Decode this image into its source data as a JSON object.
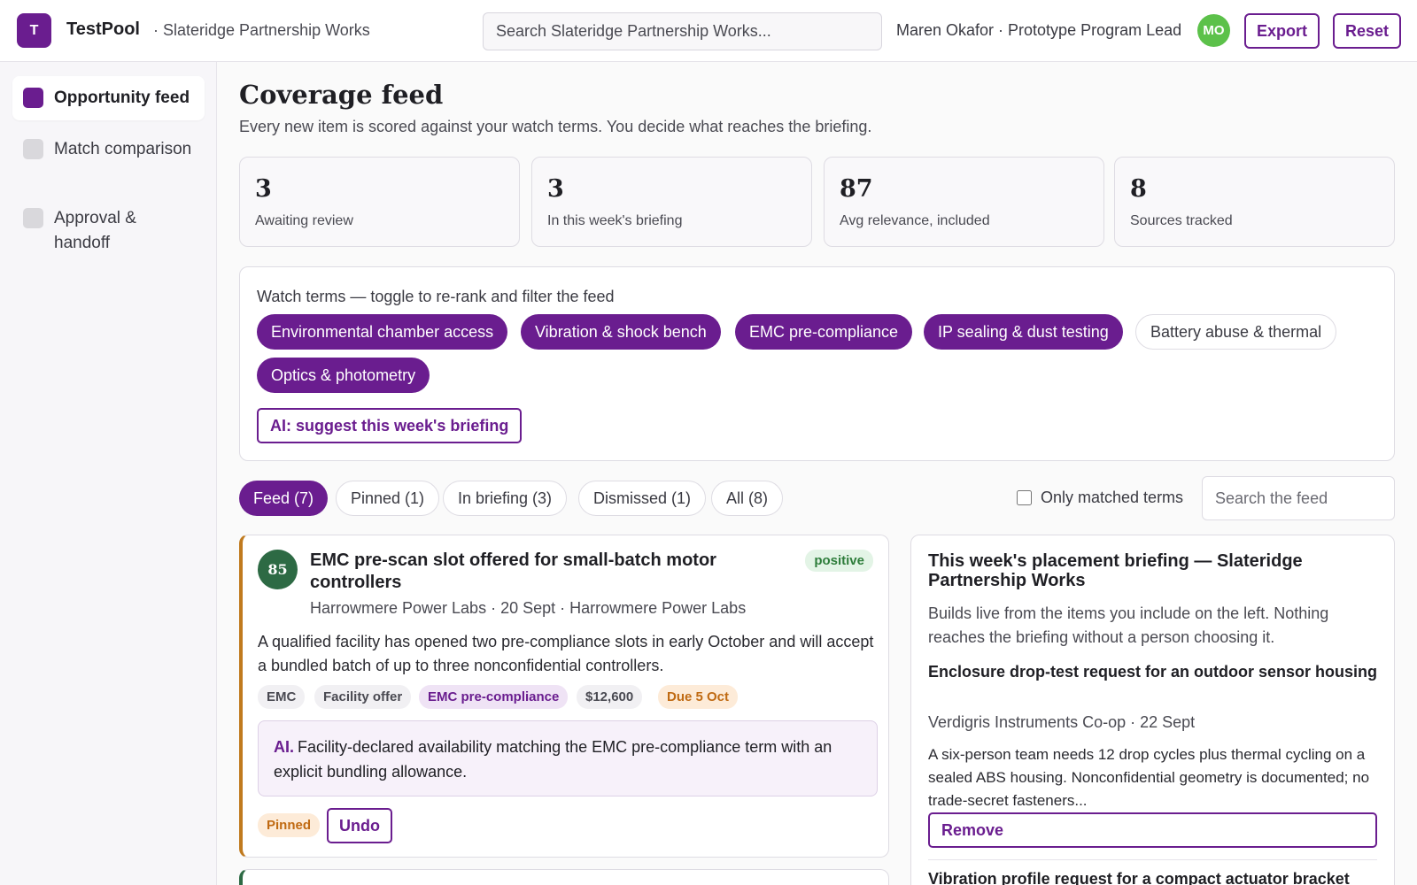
{
  "header": {
    "logo_letter": "T",
    "app_name": "TestPool",
    "org": "· Slateridge Partnership Works",
    "search_placeholder": "Search Slateridge Partnership Works...",
    "user": "Maren Okafor · Prototype Program Lead",
    "avatar_initials": "MO",
    "export_label": "Export",
    "reset_label": "Reset"
  },
  "sidebar": {
    "items": [
      {
        "label": "Opportunity feed",
        "active": true
      },
      {
        "label": "Match comparison",
        "active": false
      },
      {
        "label": "Approval & handoff",
        "active": false
      }
    ]
  },
  "main": {
    "title": "Coverage feed",
    "subtitle": "Every new item is scored against your watch terms. You decide what reaches the briefing."
  },
  "stats": [
    {
      "value": "3",
      "label": "Awaiting review"
    },
    {
      "value": "3",
      "label": "In this week's briefing"
    },
    {
      "value": "87",
      "label": "Avg relevance, included"
    },
    {
      "value": "8",
      "label": "Sources tracked"
    }
  ],
  "watch": {
    "label": "Watch terms — toggle to re-rank and filter the feed",
    "terms": [
      {
        "label": "Environmental chamber access",
        "on": true
      },
      {
        "label": "Vibration & shock bench",
        "on": true
      },
      {
        "label": "EMC pre-compliance",
        "on": true
      },
      {
        "label": "IP sealing & dust testing",
        "on": true
      },
      {
        "label": "Battery abuse & thermal",
        "on": false
      },
      {
        "label": "Optics & photometry",
        "on": true
      }
    ],
    "ai_button": "AI: suggest this week's briefing"
  },
  "tabs": [
    {
      "label": "Feed (7)",
      "active": true
    },
    {
      "label": "Pinned (1)",
      "active": false
    },
    {
      "label": "In briefing (3)",
      "active": false
    },
    {
      "label": "Dismissed (1)",
      "active": false
    },
    {
      "label": "All (8)",
      "active": false
    }
  ],
  "filter": {
    "only_matched_label": "Only matched terms",
    "only_matched_checked": false,
    "search_placeholder": "Search the feed"
  },
  "card": {
    "score": "85",
    "title": "EMC pre-scan slot offered for small-batch motor controllers",
    "sentiment": "positive",
    "meta": "Harrowmere Power Labs · 20 Sept · Harrowmere Power Labs",
    "body": "A qualified facility has opened two pre-compliance slots in early October and will accept a bundled batch of up to three nonconfidential controllers.",
    "tags": [
      "EMC",
      "Facility offer",
      "EMC pre-compliance",
      "$12,600",
      "Due 5 Oct"
    ],
    "ai_lead": "AI.",
    "ai_text": "Facility-declared availability matching the EMC pre-compliance term with an explicit bundling allowance.",
    "status": "Pinned",
    "undo_label": "Undo"
  },
  "briefing": {
    "title": "This week's placement briefing — Slateridge Partnership Works",
    "description": "Builds live from the items you include on the left. Nothing reaches the briefing without a person choosing it.",
    "item_title": "Enclosure drop-test request for an outdoor sensor housing",
    "item_meta": "Verdigris Instruments Co-op · 22 Sept",
    "item_body": "A six-person team needs 12 drop cycles plus thermal cycling on a sealed ABS housing. Nonconfidential geometry is documented; no trade-secret fasteners...",
    "remove_label": "Remove",
    "next_item_title": "Vibration profile request for a compact actuator bracket"
  },
  "colors": {
    "accent": "#6a1d8f",
    "avatar": "#5cc14a",
    "score": "#2d6a44",
    "pinned_border": "#c07a1e"
  }
}
